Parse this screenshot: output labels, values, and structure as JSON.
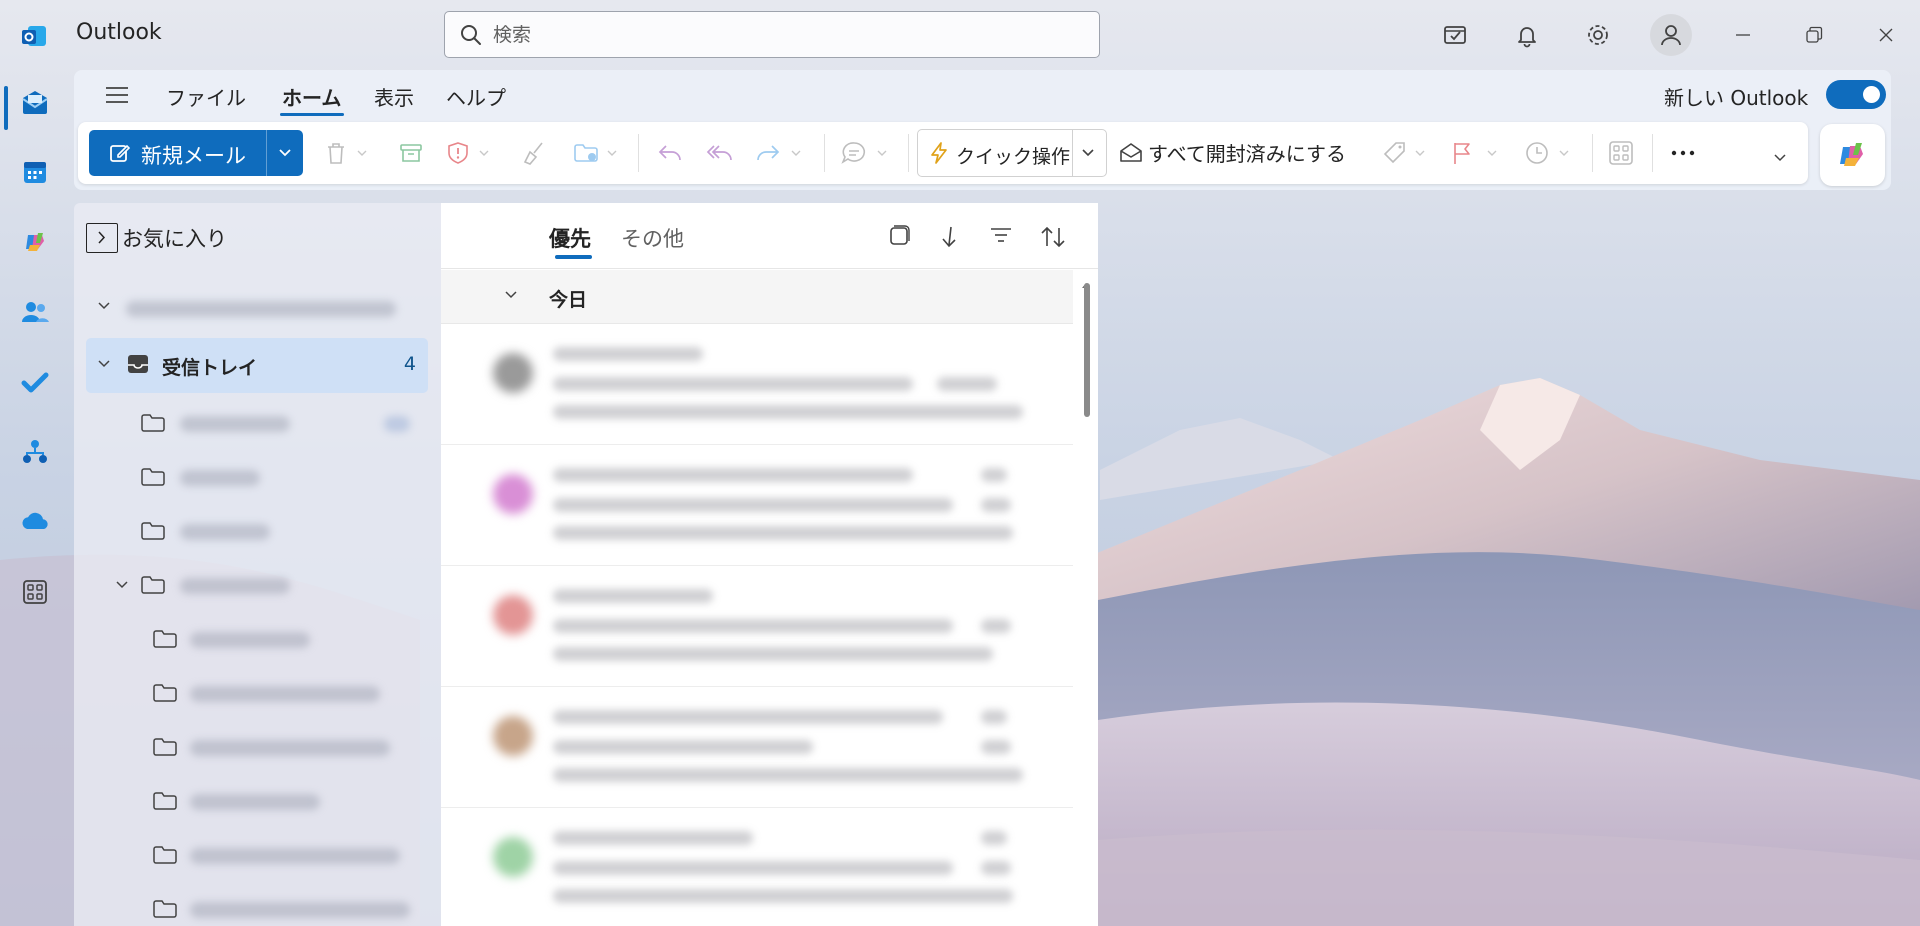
{
  "app": {
    "name": "Outlook"
  },
  "search": {
    "placeholder": "検索"
  },
  "menu": {
    "items": [
      "ファイル",
      "ホーム",
      "表示",
      "ヘルプ"
    ],
    "active_index": 1,
    "new_outlook_label": "新しい Outlook",
    "new_outlook_enabled": true
  },
  "toolbar": {
    "new_mail_label": "新規メール",
    "quick_actions_label": "クイック操作",
    "mark_all_read_label": "すべて開封済みにする"
  },
  "folders": {
    "favorites_label": "お気に入り",
    "inbox_label": "受信トレイ",
    "inbox_count": "4"
  },
  "message_list": {
    "tabs": [
      "優先",
      "その他"
    ],
    "active_tab": 0,
    "group_label": "今日"
  },
  "colors": {
    "accent": "#0f6cbd",
    "inbox_highlight": "#cfe0f6"
  },
  "icons": {
    "titlebar": [
      "tasks-icon",
      "bell-icon",
      "settings-icon",
      "account-icon",
      "minimize-icon",
      "restore-icon",
      "close-icon"
    ],
    "rail": [
      "mail-icon",
      "calendar-icon",
      "copilot-icon",
      "people-icon",
      "todo-icon",
      "org-explorer-icon",
      "onedrive-icon",
      "apps-icon"
    ]
  }
}
